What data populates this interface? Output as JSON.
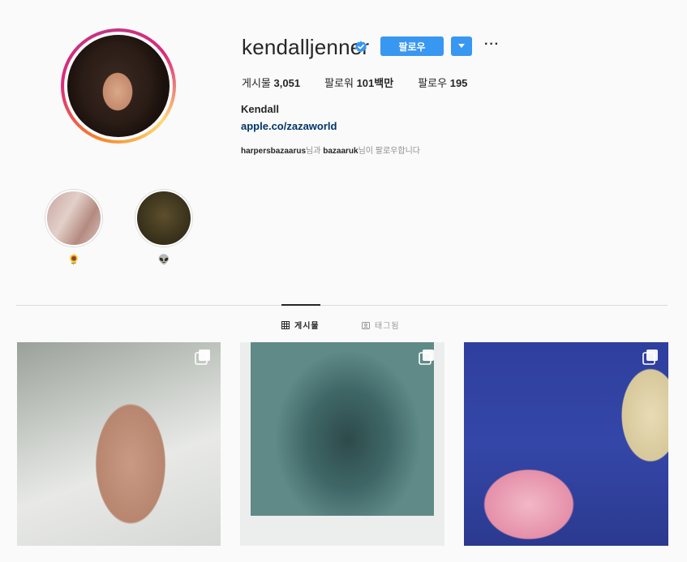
{
  "profile": {
    "username": "kendalljenner",
    "follow_label": "팔로우",
    "more_label": "···",
    "stats": [
      {
        "label": "게시물",
        "value": "3,051"
      },
      {
        "label": "팔로워",
        "value": "101백만"
      },
      {
        "label": "팔로우",
        "value": "195"
      }
    ],
    "full_name": "Kendall",
    "website": "apple.co/zazaworld",
    "followed_by": {
      "user1": "harpersbazaarus",
      "joiner": "님과",
      "user2": "bazaaruk",
      "suffix": "님이 팔로우합니다"
    }
  },
  "highlights": [
    {
      "label": "🌻"
    },
    {
      "label": "👽"
    }
  ],
  "tabs": [
    {
      "label": "게시물",
      "active": true,
      "icon": "grid-icon"
    },
    {
      "label": "태그됨",
      "active": false,
      "icon": "tag-icon"
    }
  ],
  "colors": {
    "accent": "#3897f0",
    "link": "#003569",
    "verified": "#3897f0"
  }
}
